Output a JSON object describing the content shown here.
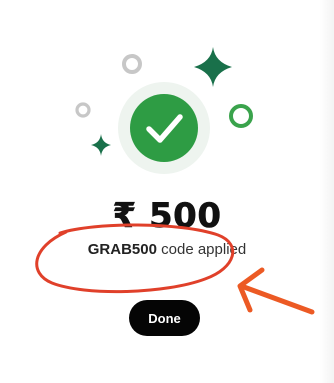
{
  "dialog": {
    "amount": "₹ 500",
    "code": "GRAB500",
    "code_suffix": " code applied",
    "done_label": "Done"
  },
  "colors": {
    "success_green": "#2e9c44",
    "sparkle_green": "#19704a",
    "ring_gray": "#c7c7c7",
    "annotation_red": "#e0402a",
    "arrow_orange": "#ec5a24",
    "button_bg": "#050505"
  },
  "icons": {
    "success": "check-circle-icon",
    "sparkle": "sparkle-star-icon",
    "ring": "ring-icon"
  }
}
